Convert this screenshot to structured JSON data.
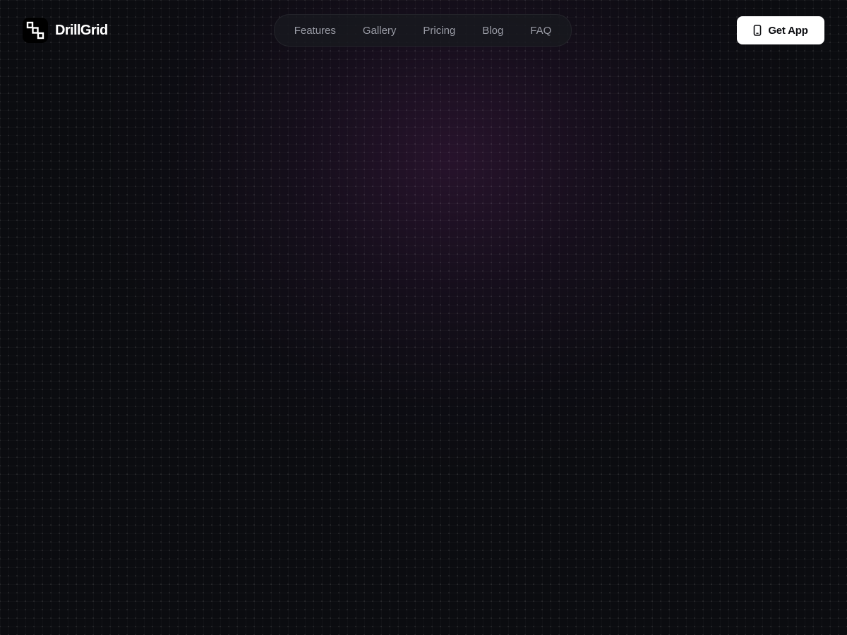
{
  "brand": {
    "name": "DrillGrid",
    "logo_icon": "squares-stairs-icon"
  },
  "nav": {
    "items": [
      {
        "label": "Features"
      },
      {
        "label": "Gallery"
      },
      {
        "label": "Pricing"
      },
      {
        "label": "Blog"
      },
      {
        "label": "FAQ"
      }
    ]
  },
  "cta": {
    "label": "Get App",
    "icon": "smartphone-icon"
  },
  "colors": {
    "background": "#0b0c10",
    "glow": "#3e1842",
    "nav_text": "#9a9ca6",
    "cta_background": "#ffffff"
  }
}
